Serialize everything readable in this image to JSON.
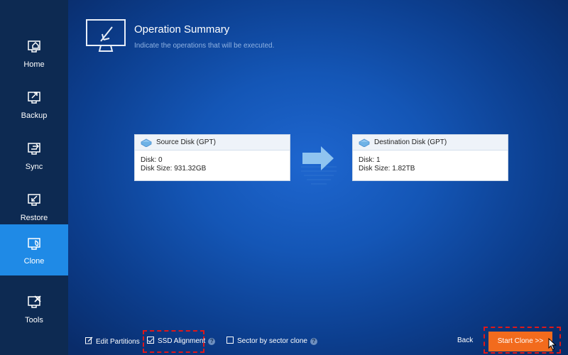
{
  "sidebar": {
    "items": [
      {
        "label": "Home",
        "icon": "home-icon"
      },
      {
        "label": "Backup",
        "icon": "backup-icon"
      },
      {
        "label": "Sync",
        "icon": "sync-icon"
      },
      {
        "label": "Restore",
        "icon": "restore-icon"
      },
      {
        "label": "Clone",
        "icon": "clone-icon",
        "active": true
      },
      {
        "label": "Tools",
        "icon": "tools-icon"
      }
    ]
  },
  "header": {
    "title": "Operation Summary",
    "subtitle": "Indicate the operations that will be executed."
  },
  "source_disk": {
    "name": "Source Disk (GPT)",
    "disk": "Disk: 0",
    "size": "Disk Size: 931.32GB"
  },
  "destination_disk": {
    "name": "Destination Disk (GPT)",
    "disk": "Disk: 1",
    "size": "Disk Size: 1.82TB"
  },
  "options": {
    "edit_partitions": {
      "label": "Edit Partitions",
      "checked": true
    },
    "ssd_alignment": {
      "label": "SSD Alignment",
      "checked": true
    },
    "sector_by_sector": {
      "label": "Sector by sector clone",
      "checked": false
    }
  },
  "buttons": {
    "back": "Back",
    "start_clone": "Start Clone >>"
  },
  "colors": {
    "sidebar_bg": "#0d2a52",
    "active_nav": "#1f8ae6",
    "start_button": "#f26b1d",
    "highlight": "#e01818"
  }
}
